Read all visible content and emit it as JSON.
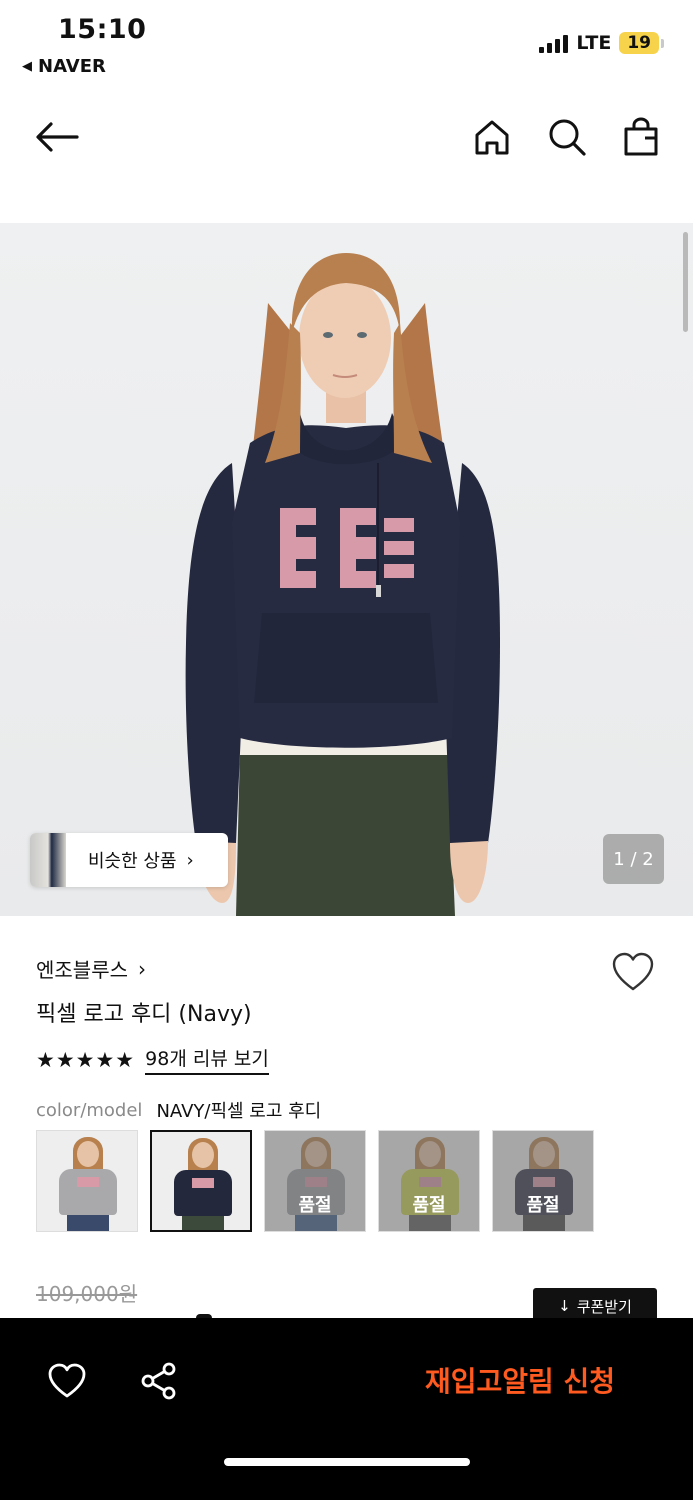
{
  "status_bar": {
    "time": "15:10",
    "back_app": "NAVER",
    "back_icon": "back-triangle-icon",
    "network": "LTE",
    "battery": "19",
    "battery_color": "#f6d34a"
  },
  "nav": {
    "back_icon": "arrow-left-icon",
    "home_icon": "home-icon",
    "search_icon": "search-icon",
    "bag_icon": "shopping-bag-icon"
  },
  "hero": {
    "similar_label": "비슷한 상품",
    "similar_chevron": "›",
    "page_counter": "1 / 2"
  },
  "product": {
    "brand": "엔조블루스",
    "brand_chevron": "›",
    "name": "픽셀 로고 후디 (Navy)",
    "stars": "★★★★★",
    "rating_stars": 5,
    "review_link": "98개 리뷰 보기",
    "option_label": "color/model",
    "option_value": "NAVY/픽셀 로고 후디"
  },
  "swatches": [
    {
      "name": "grey",
      "body_color": "#a9a9ab",
      "legs_color": "#3a4a6a",
      "selected": false,
      "soldout": ""
    },
    {
      "name": "navy",
      "body_color": "#24283d",
      "legs_color": "#3b4a3a",
      "selected": true,
      "soldout": ""
    },
    {
      "name": "grey-blue",
      "body_color": "#9a9da3",
      "legs_color": "#3a5a8a",
      "selected": false,
      "soldout": "품절"
    },
    {
      "name": "lime",
      "body_color": "#c9d14a",
      "legs_color": "#5a5a5a",
      "selected": false,
      "soldout": "품절"
    },
    {
      "name": "navy-dark",
      "body_color": "#2a2d44",
      "legs_color": "#444",
      "selected": false,
      "soldout": "품절"
    }
  ],
  "pricing": {
    "original_price": "109,000원",
    "coupon_label": "쿠폰받기",
    "coupon_icon": "arrow-down-icon"
  },
  "bottom_bar": {
    "wish_icon": "heart-icon",
    "share_icon": "share-icon",
    "restock_label": "재입고알림 신청",
    "restock_color": "#ff5a1f"
  }
}
